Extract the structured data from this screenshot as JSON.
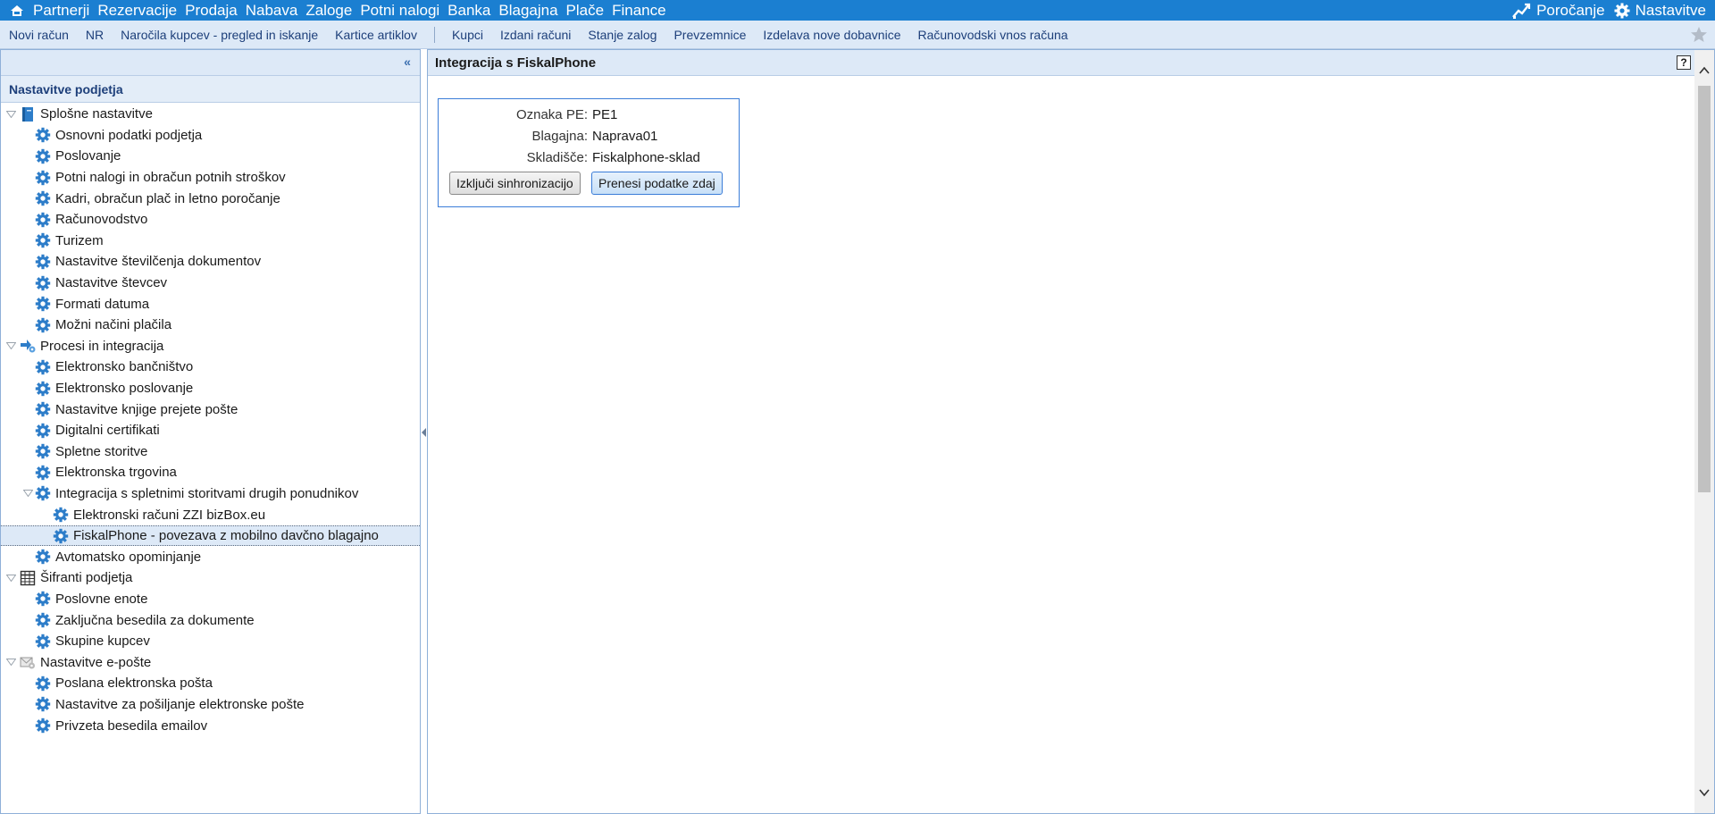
{
  "topbar": {
    "menu": [
      "Partnerji",
      "Rezervacije",
      "Prodaja",
      "Nabava",
      "Zaloge",
      "Potni nalogi",
      "Banka",
      "Blagajna",
      "Plače",
      "Finance"
    ],
    "reporting_label": "Poročanje",
    "settings_label": "Nastavitve"
  },
  "toolbar": {
    "links_a": [
      "Novi račun",
      "NR",
      "Naročila kupcev - pregled in iskanje",
      "Kartice artiklov"
    ],
    "links_b": [
      "Kupci",
      "Izdani računi",
      "Stanje zalog",
      "Prevzemnice",
      "Izdelava nove dobavnice",
      "Računovodski vnos računa"
    ]
  },
  "leftpanel": {
    "title": "Nastavitve podjetja",
    "tree": [
      {
        "level": 0,
        "label": "Splošne nastavitve",
        "icon": "book-icon",
        "expanded": true
      },
      {
        "level": 1,
        "label": "Osnovni podatki podjetja",
        "icon": "gear-icon"
      },
      {
        "level": 1,
        "label": "Poslovanje",
        "icon": "gear-icon"
      },
      {
        "level": 1,
        "label": "Potni nalogi in obračun potnih stroškov",
        "icon": "gear-icon"
      },
      {
        "level": 1,
        "label": "Kadri, obračun plač in letno poročanje",
        "icon": "gear-icon"
      },
      {
        "level": 1,
        "label": "Računovodstvo",
        "icon": "gear-icon"
      },
      {
        "level": 1,
        "label": "Turizem",
        "icon": "gear-icon"
      },
      {
        "level": 1,
        "label": "Nastavitve številčenja dokumentov",
        "icon": "gear-icon"
      },
      {
        "level": 1,
        "label": "Nastavitve števcev",
        "icon": "gear-icon"
      },
      {
        "level": 1,
        "label": "Formati datuma",
        "icon": "gear-icon"
      },
      {
        "level": 1,
        "label": "Možni načini plačila",
        "icon": "gear-icon"
      },
      {
        "level": 0,
        "label": "Procesi in integracija",
        "icon": "process-icon",
        "expanded": true
      },
      {
        "level": 1,
        "label": "Elektronsko bančništvo",
        "icon": "gear-icon"
      },
      {
        "level": 1,
        "label": "Elektronsko poslovanje",
        "icon": "gear-icon"
      },
      {
        "level": 1,
        "label": "Nastavitve knjige prejete pošte",
        "icon": "gear-icon"
      },
      {
        "level": 1,
        "label": "Digitalni certifikati",
        "icon": "gear-icon"
      },
      {
        "level": 1,
        "label": "Spletne storitve",
        "icon": "gear-icon"
      },
      {
        "level": 1,
        "label": "Elektronska trgovina",
        "icon": "gear-icon"
      },
      {
        "level": 1,
        "label": "Integracija s spletnimi storitvami drugih ponudnikov",
        "icon": "gear-icon",
        "expanded": true
      },
      {
        "level": 2,
        "label": "Elektronski računi ZZI bizBox.eu",
        "icon": "gear-icon"
      },
      {
        "level": 2,
        "label": "FiskalPhone - povezava z mobilno davčno blagajno",
        "icon": "gear-icon",
        "selected": true
      },
      {
        "level": 1,
        "label": "Avtomatsko opominjanje",
        "icon": "gear-icon"
      },
      {
        "level": 0,
        "label": "Šifranti podjetja",
        "icon": "table-icon",
        "expanded": true
      },
      {
        "level": 1,
        "label": "Poslovne enote",
        "icon": "gear-icon"
      },
      {
        "level": 1,
        "label": "Zaključna besedila za dokumente",
        "icon": "gear-icon"
      },
      {
        "level": 1,
        "label": "Skupine kupcev",
        "icon": "gear-icon"
      },
      {
        "level": 0,
        "label": "Nastavitve e-pošte",
        "icon": "email-settings-icon",
        "expanded": true
      },
      {
        "level": 1,
        "label": "Poslana elektronska pošta",
        "icon": "gear-icon"
      },
      {
        "level": 1,
        "label": "Nastavitve za pošiljanje elektronske pošte",
        "icon": "gear-icon"
      },
      {
        "level": 1,
        "label": "Privzeta besedila emailov",
        "icon": "gear-icon"
      }
    ]
  },
  "main": {
    "title": "Integracija s FiskalPhone",
    "help_label": "?",
    "form": {
      "pe_label": "Oznaka PE:",
      "pe_value": "PE1",
      "register_label": "Blagajna:",
      "register_value": "Naprava01",
      "warehouse_label": "Skladišče:",
      "warehouse_value": "Fiskalphone-sklad",
      "disable_sync_button": "Izključi sinhronizacijo",
      "transfer_now_button": "Prenesi podatke zdaj"
    }
  },
  "colors": {
    "topbar": "#1b7fd1",
    "toolbar": "#dde9f7",
    "border": "#8fb0d8",
    "link": "#1d3f7a",
    "gear": "#2d7dc9"
  }
}
